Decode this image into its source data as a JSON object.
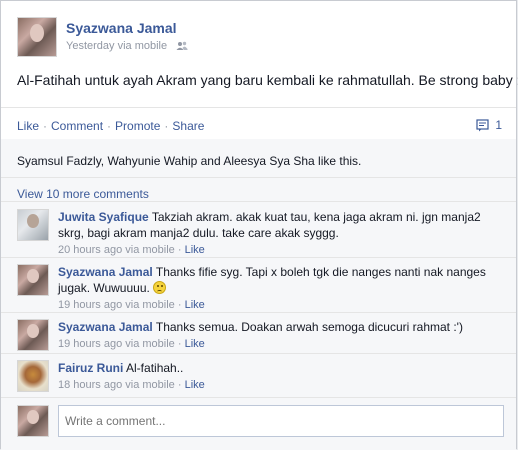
{
  "post": {
    "author": "Syazwana Jamal",
    "time": "Yesterday via mobile",
    "audience_icon": "friends-icon",
    "text": "Al-Fatihah untuk ayah Akram yang baru kembali ke rahmatullah. Be strong baby :'("
  },
  "actions": {
    "like": "Like",
    "comment": "Comment",
    "promote": "Promote",
    "share": "Share",
    "separator": "·",
    "comment_count": "1"
  },
  "ufi": {
    "likes_text": "Syamsul Fadzly, Wahyunie Wahip and Aleesya Sya Sha like this.",
    "view_more": "View 10 more comments",
    "comments": [
      {
        "author": "Juwita Syafique",
        "text": "Takziah akram. akak kuat tau, kena jaga akram ni. jgn manja2 skrg, bagi akram manja2 dulu. take care akak syggg.",
        "time": "20 hours ago via mobile",
        "like": "Like"
      },
      {
        "author": "Syazwana Jamal",
        "text": "Thanks fifie syg. Tapi x boleh tgk die nanges nanti nak nanges jugak. Wuwuuuu.",
        "time": "19 hours ago via mobile",
        "like": "Like"
      },
      {
        "author": "Syazwana Jamal",
        "text": "Thanks semua. Doakan arwah semoga dicucuri rahmat :')",
        "time": "19 hours ago via mobile",
        "like": "Like"
      },
      {
        "author": "Fairuz Runi",
        "text": "Al-fatihah..",
        "time": "18 hours ago via mobile",
        "like": "Like"
      }
    ],
    "write_placeholder": "Write a comment..."
  },
  "colors": {
    "link": "#3b5998",
    "meta": "#9197a3",
    "ufi_background": "#f6f7f9"
  }
}
